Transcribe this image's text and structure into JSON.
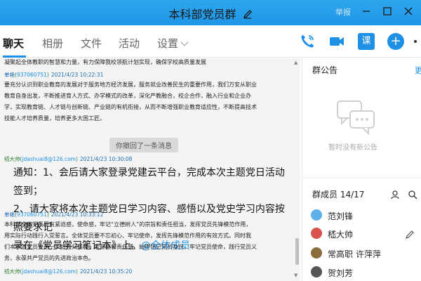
{
  "window": {
    "title": "本科部党员群",
    "report_label": "举报"
  },
  "tabs": [
    {
      "label": "聊天",
      "active": true
    },
    {
      "label": "相册"
    },
    {
      "label": "文件"
    },
    {
      "label": "活动"
    },
    {
      "label": "设置"
    }
  ],
  "toolbar": {
    "class_label": "课",
    "plus_label": "+"
  },
  "chat": {
    "messages": [
      {
        "body": "凝聚起全体教职的智慧和力量，有力保障我校领航计划实现，确保学校高质量发展"
      },
      {
        "sender": "单艳",
        "email": "937060751",
        "time": "2021/4/23 10:22:31",
        "lines": [
          "要充分认识到职业教育的发展对于服务地方经济发展，服务就业改善民生的重要作用，我们万安从职业",
          "教育自身出发，不断推进育人方式、办学模式的改革，深化产教融合，校企合作，融入行业和企业办",
          "学，实现教育链、人才链与创新链、产业链的有机衔接，从而不断增强职业教育适应性，不断提高技术",
          "技能人才培养质量，培养更多大国工匠。"
        ]
      },
      {
        "recall": "你撤回了一条消息"
      },
      {
        "sender": "嵇大帅",
        "email": "jdashuai8@126.com",
        "time": "2021/4/23 10:30:08",
        "lines_big": [
          "通知：1、会后请大家登录党建云平台，完成本次主题党日活动签到；",
          "2、请大家将本次主题党日学习内容、感悟以及党史学习内容按照要求记",
          "录在《党员学习笔记本》上。"
        ],
        "mention": "@全体成员"
      },
      {
        "sender": "单艳",
        "email": "937060751",
        "time": "2021/4/23 10:33:12",
        "lines": [
          "本科部全体党员要有紧迫感，使命感，牢记“立德树人”的宗旨和责任担当，发挥党员先锋模范作用，",
          "用实际行动践行入党誓言。全体党员要不忘初心、牢记使命，发挥先锋模范作用的有效方式。同时我",
          "们本科部党员要进一步增强归属感，荣誉感和责任感，始终铭记党员身份，牢记党员使命，践行党员义",
          "务，永葆共产党员的先进政治本色。"
        ]
      },
      {
        "sender": "嵇大帅",
        "email": "jdashuai8@126.com",
        "time": "2021/4/23 10:35:20"
      }
    ]
  },
  "sidebar": {
    "notice_title": "群公告",
    "notice_more": "更",
    "notice_empty": "暂时没有新公告",
    "members_title": "群成员 14/17",
    "members": [
      {
        "name": "范刘锋",
        "avatar_color": "#5fb0e8"
      },
      {
        "name": "嵇大帅",
        "avatar_color": "#d9534f"
      },
      {
        "name": "常高职 许萍萍",
        "avatar_color": "#8a6d3b"
      },
      {
        "name": "贺刘芳",
        "avatar_color": "#555555"
      }
    ]
  },
  "colors": {
    "accent": "#1e90e6",
    "titlebar": "#1f95e6"
  }
}
